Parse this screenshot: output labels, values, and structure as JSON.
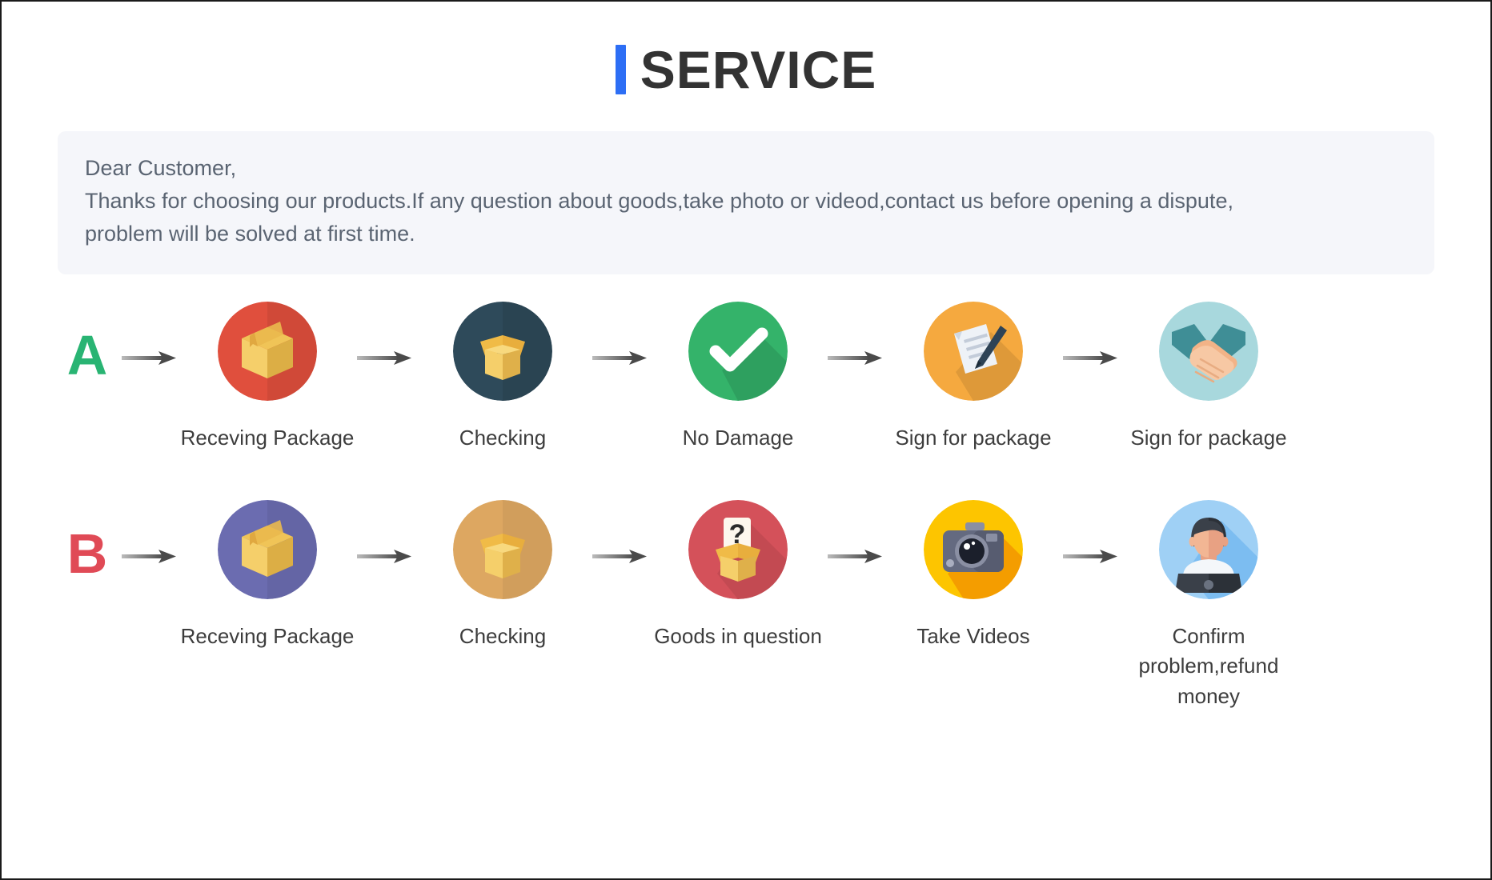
{
  "header": {
    "title": "SERVICE",
    "accent_color": "#2d6ef5",
    "title_color": "#333333"
  },
  "notice": {
    "background_color": "#f5f6fa",
    "text_color": "#5a6472",
    "line1": "Dear Customer,",
    "line2": "Thanks for choosing our products.If any question about goods,take photo or videod,contact us before opening a dispute,",
    "line3": "problem will be solved at first time."
  },
  "arrow": {
    "icon": "arrow-right-icon",
    "color": "#555555"
  },
  "rows": [
    {
      "letter": "A",
      "letter_color": "#29b473",
      "steps": [
        {
          "label": "Receving Package",
          "icon": "package-box-icon",
          "circle_color": "#e04f3d"
        },
        {
          "label": "Checking",
          "icon": "open-box-icon",
          "circle_color": "#2e4a5a"
        },
        {
          "label": "No Damage",
          "icon": "checkmark-icon",
          "circle_color": "#34b36a"
        },
        {
          "label": "Sign for package",
          "icon": "sign-document-icon",
          "circle_color": "#f5a93f"
        },
        {
          "label": "Sign for package",
          "icon": "handshake-icon",
          "circle_color": "#a8d8dd"
        }
      ]
    },
    {
      "letter": "B",
      "letter_color": "#e04a56",
      "steps": [
        {
          "label": "Receving Package",
          "icon": "package-box-icon",
          "circle_color": "#6b6cb0"
        },
        {
          "label": "Checking",
          "icon": "open-box-icon",
          "circle_color": "#dda761"
        },
        {
          "label": "Goods in question",
          "icon": "question-box-icon",
          "circle_color": "#d4515a"
        },
        {
          "label": "Take Videos",
          "icon": "camera-icon",
          "circle_color": "#fdc500"
        },
        {
          "label": "Confirm problem,refund money",
          "icon": "support-agent-icon",
          "circle_color": "#9fd0f5"
        }
      ]
    }
  ]
}
